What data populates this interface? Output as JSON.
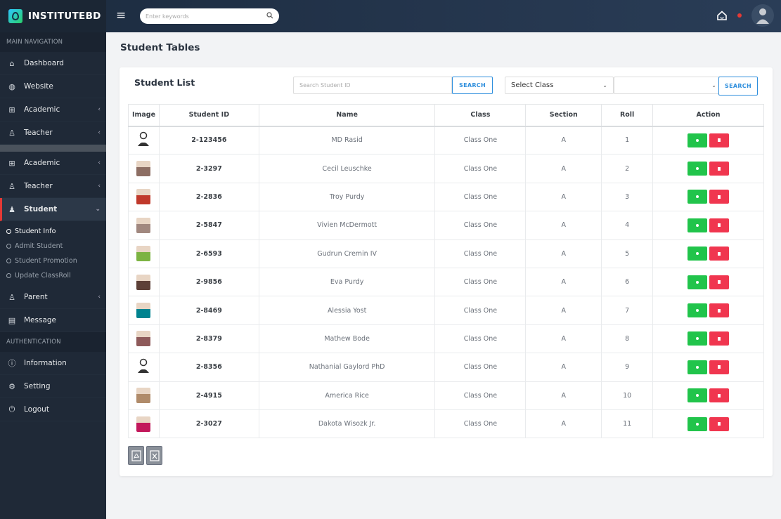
{
  "brand": {
    "name": "INSTITUTEBD"
  },
  "topbar": {
    "search_placeholder": "Enter keywords"
  },
  "sidebar": {
    "main_header": "MAIN NAVIGATION",
    "items_top": [
      {
        "label": "Dashboard",
        "icon": "home-icon",
        "chevron": false
      },
      {
        "label": "Website",
        "icon": "globe-icon",
        "chevron": false
      },
      {
        "label": "Academic",
        "icon": "grid-icon",
        "chevron": true
      },
      {
        "label": "Teacher",
        "icon": "user-icon",
        "chevron": true
      }
    ],
    "items_mid": [
      {
        "label": "Academic",
        "icon": "grid-icon",
        "chevron": true
      },
      {
        "label": "Teacher",
        "icon": "user-icon",
        "chevron": true
      }
    ],
    "student": {
      "label": "Student",
      "icon": "users-icon"
    },
    "student_sub": [
      "Student Info",
      "Admit Student",
      "Student Promotion",
      "Update ClassRoll"
    ],
    "items_bottom": [
      {
        "label": "Parent",
        "icon": "user-icon",
        "chevron": true
      },
      {
        "label": "Message",
        "icon": "message-icon",
        "chevron": false
      }
    ],
    "auth_header": "AUTHENTICATION",
    "auth_items": [
      {
        "label": "Information",
        "icon": "info-icon"
      },
      {
        "label": "Setting",
        "icon": "gear-icon"
      },
      {
        "label": "Logout",
        "icon": "power-icon"
      }
    ]
  },
  "page": {
    "title": "Student Tables"
  },
  "card": {
    "title": "Student List",
    "student_id_placeholder": "Search Student ID",
    "search_label": "SEARCH",
    "select_class": "Select Class",
    "select_section": "",
    "search2_label": "SEARCH"
  },
  "table": {
    "headers": [
      "Image",
      "Student ID",
      "Name",
      "Class",
      "Section",
      "Roll",
      "Action"
    ],
    "rows": [
      {
        "img": "placeholder",
        "id": "2-123456",
        "name": "MD Rasid",
        "class": "Class One",
        "section": "A",
        "roll": "1"
      },
      {
        "img": "#8d6e63",
        "id": "2-3297",
        "name": "Cecil Leuschke",
        "class": "Class One",
        "section": "A",
        "roll": "2"
      },
      {
        "img": "#c0392b",
        "id": "2-2836",
        "name": "Troy Purdy",
        "class": "Class One",
        "section": "A",
        "roll": "3"
      },
      {
        "img": "#a1887f",
        "id": "2-5847",
        "name": "Vivien McDermott",
        "class": "Class One",
        "section": "A",
        "roll": "4"
      },
      {
        "img": "#7cb342",
        "id": "2-6593",
        "name": "Gudrun Cremin IV",
        "class": "Class One",
        "section": "A",
        "roll": "5"
      },
      {
        "img": "#5d4037",
        "id": "2-9856",
        "name": "Eva Purdy",
        "class": "Class One",
        "section": "A",
        "roll": "6"
      },
      {
        "img": "#00838f",
        "id": "2-8469",
        "name": "Alessia Yost",
        "class": "Class One",
        "section": "A",
        "roll": "7"
      },
      {
        "img": "#8e5a5a",
        "id": "2-8379",
        "name": "Mathew Bode",
        "class": "Class One",
        "section": "A",
        "roll": "8"
      },
      {
        "img": "placeholder",
        "id": "2-8356",
        "name": "Nathanial Gaylord PhD",
        "class": "Class One",
        "section": "A",
        "roll": "9"
      },
      {
        "img": "#b08b6a",
        "id": "2-4915",
        "name": "America Rice",
        "class": "Class One",
        "section": "A",
        "roll": "10"
      },
      {
        "img": "#c2185b",
        "id": "2-3027",
        "name": "Dakota Wisozk Jr.",
        "class": "Class One",
        "section": "A",
        "roll": "11"
      }
    ]
  },
  "colors": {
    "view_button": "#21c44b",
    "delete_button": "#f0364f",
    "accent": "#2f8fdd"
  }
}
